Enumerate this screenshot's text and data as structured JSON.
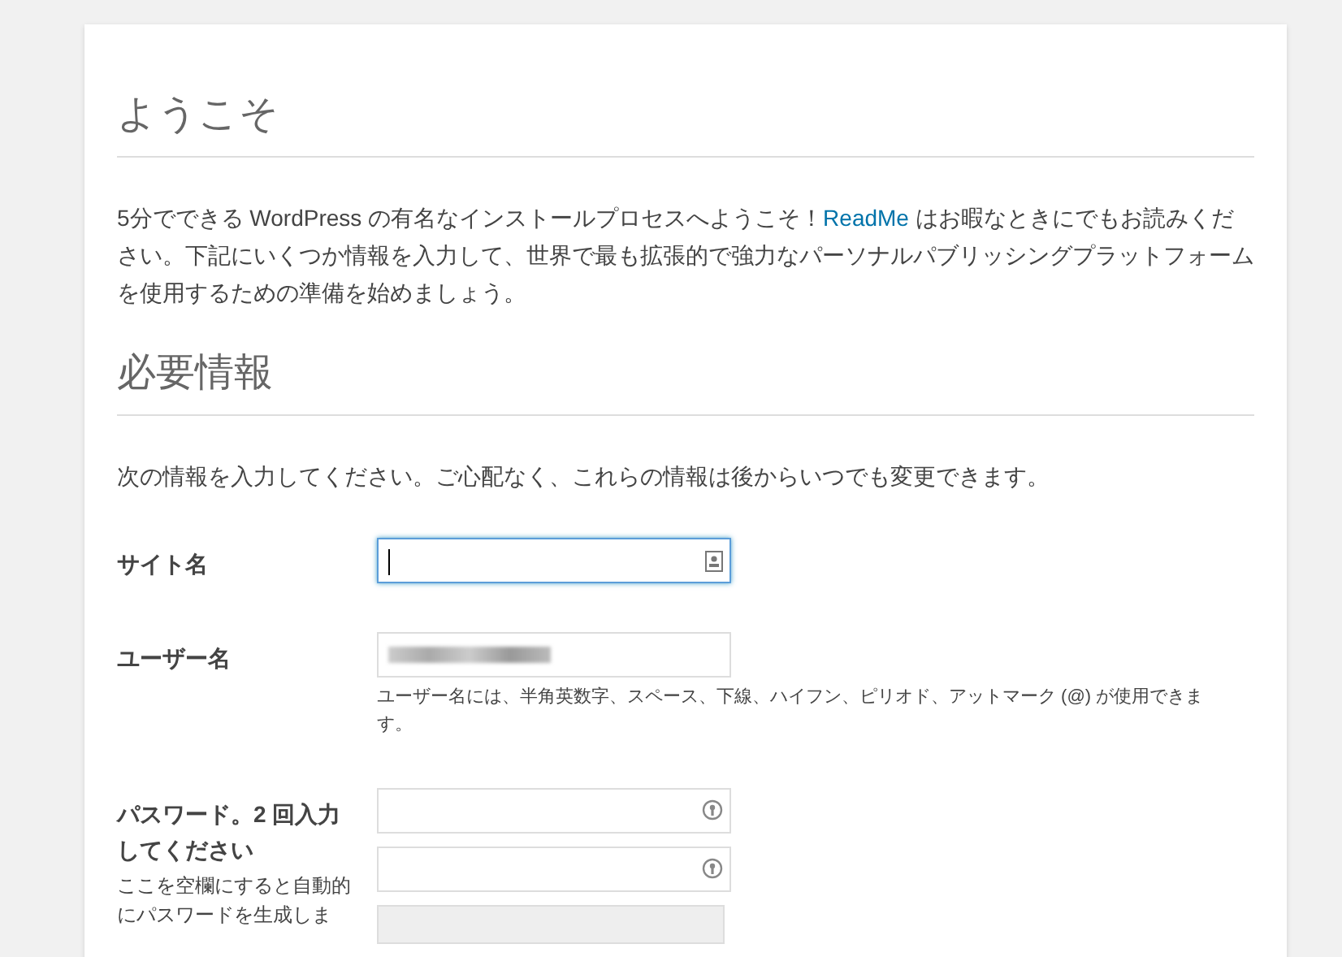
{
  "welcome": {
    "heading": "ようこそ",
    "intro_before": "5分でできる WordPress の有名なインストールプロセスへようこそ！",
    "readme_link": "ReadMe",
    "intro_after": " はお暇なときにでもお読みください。下記にいくつか情報を入力して、世界で最も拡張的で強力なパーソナルパブリッシングプラットフォームを使用するための準備を始めましょう。"
  },
  "required": {
    "heading": "必要情報",
    "intro": "次の情報を入力してください。ご心配なく、これらの情報は後からいつでも変更できます。"
  },
  "fields": [
    {
      "kind": "site",
      "label": "サイト名",
      "focused": true
    },
    {
      "kind": "user",
      "label": "ユーザー名",
      "focused": false,
      "hint": "ユーザー名には、半角英数字、スペース、下線、ハイフン、ピリオド、アットマーク (@) が使用できます。"
    },
    {
      "kind": "password",
      "label": "パスワード。2 回入力してください",
      "focused": false,
      "hint": "ここを空欄にすると自動的にパスワードを生成しま"
    }
  ]
}
